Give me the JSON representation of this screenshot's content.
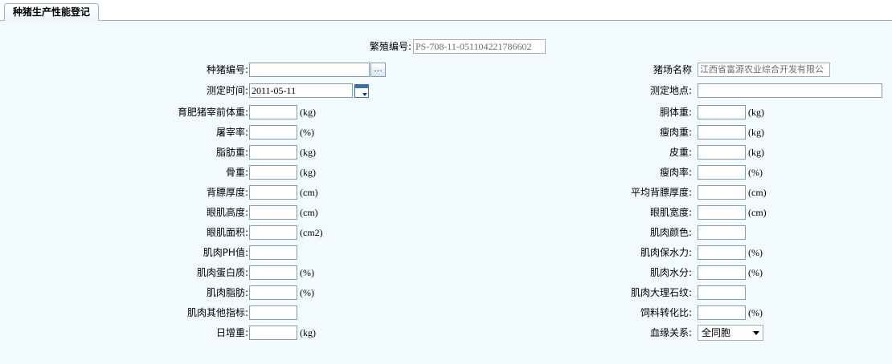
{
  "tab": {
    "title": "种猪生产性能登记"
  },
  "breeding_no": {
    "label": "繁殖编号:",
    "value": "PS-708-11-051104221786602"
  },
  "left": {
    "pig_no": {
      "label": "种猪编号:",
      "value": "",
      "browse": "..."
    },
    "test_time": {
      "label": "测定时间:",
      "value": "2011-05-11"
    },
    "rows": [
      {
        "label": "育肥猪宰前体重:",
        "unit": "(kg)"
      },
      {
        "label": "屠宰率:",
        "unit": "(%)"
      },
      {
        "label": "脂肪重:",
        "unit": "(kg)"
      },
      {
        "label": "骨重:",
        "unit": "(kg)"
      },
      {
        "label": "背膘厚度:",
        "unit": "(cm)"
      },
      {
        "label": "眼肌高度:",
        "unit": "(cm)"
      },
      {
        "label": "眼肌面积:",
        "unit": "(cm2)"
      },
      {
        "label": "肌肉PH值:",
        "unit": ""
      },
      {
        "label": "肌肉蛋白质:",
        "unit": "(%)"
      },
      {
        "label": "肌肉脂肪:",
        "unit": "(%)"
      },
      {
        "label": "肌肉其他指标:",
        "unit": ""
      },
      {
        "label": "日增重:",
        "unit": "(kg)"
      }
    ]
  },
  "right": {
    "farm_name": {
      "label": "猪场名称",
      "value": "江西省富源农业综合开发有限公"
    },
    "test_place": {
      "label": "测定地点:",
      "value": ""
    },
    "rows": [
      {
        "label": "胴体重:",
        "unit": "(kg)"
      },
      {
        "label": "瘦肉重:",
        "unit": "(kg)"
      },
      {
        "label": "皮重:",
        "unit": "(kg)"
      },
      {
        "label": "瘦肉率:",
        "unit": "(%)"
      },
      {
        "label": "平均背膘厚度:",
        "unit": "(cm)"
      },
      {
        "label": "眼肌宽度:",
        "unit": "(cm)"
      },
      {
        "label": "肌肉颜色:",
        "unit": ""
      },
      {
        "label": "肌肉保水力:",
        "unit": "(%)"
      },
      {
        "label": "肌肉水分:",
        "unit": "(%)"
      },
      {
        "label": "肌肉大理石纹:",
        "unit": ""
      },
      {
        "label": "饲料转化比:",
        "unit": "(%)"
      },
      {
        "label": "血缘关系:",
        "select_value": "全同胞"
      }
    ]
  }
}
